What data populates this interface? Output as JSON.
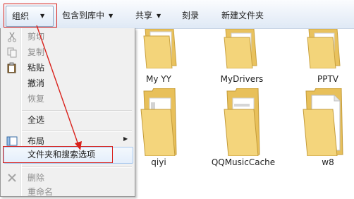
{
  "toolbar": {
    "organize": "组织",
    "include_in_library": "包含到库中",
    "share": "共享",
    "burn": "刻录",
    "new_folder": "新建文件夹"
  },
  "folders": [
    {
      "name": "My YY"
    },
    {
      "name": "MyDrivers"
    },
    {
      "name": "PPTV"
    },
    {
      "name": "qiyi"
    },
    {
      "name": "QQMusicCache"
    },
    {
      "name": "w8"
    }
  ],
  "menu": {
    "cut": "剪切",
    "copy": "复制",
    "paste": "粘贴",
    "undo": "撤消",
    "redo": "恢复",
    "select_all": "全选",
    "layout": "布局",
    "folder_options": "文件夹和搜索选项",
    "delete": "删除",
    "rename": "重命名"
  },
  "colors": {
    "annotation": "#d9221c",
    "folder": "#f1cd6a",
    "highlight_border": "#a8c8ee"
  }
}
